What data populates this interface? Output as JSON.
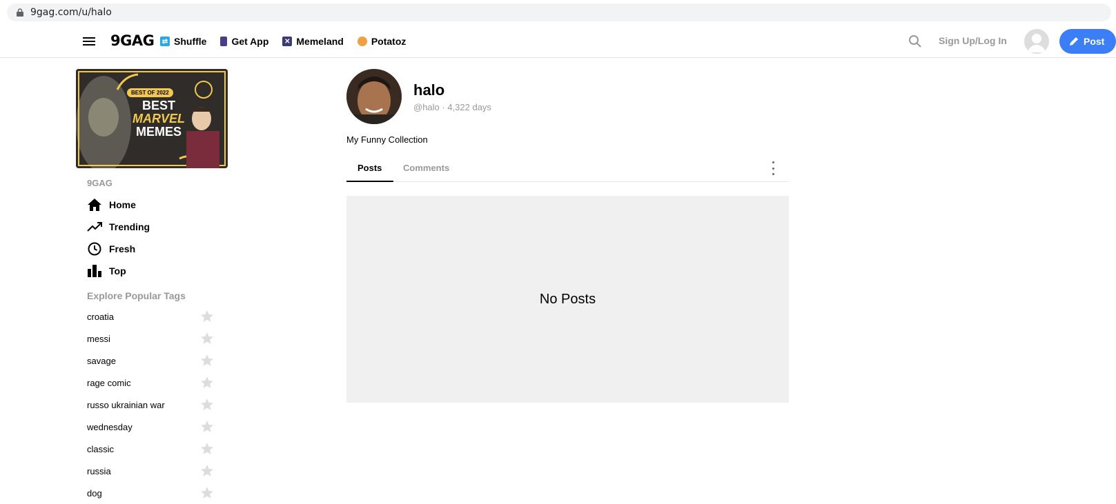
{
  "browser": {
    "url": "9gag.com/u/halo"
  },
  "header": {
    "logo": "9GAG",
    "nav": [
      {
        "label": "Shuffle",
        "icon": "shuffle-icon",
        "color": "#2aa7e8"
      },
      {
        "label": "Get App",
        "icon": "phone-icon",
        "color": "#4a3b8c"
      },
      {
        "label": "Memeland",
        "icon": "memeland-icon",
        "color": "#3b3a7a"
      },
      {
        "label": "Potatoz",
        "icon": "potato-icon",
        "color": "#f0a040"
      }
    ],
    "login_label": "Sign Up/Log In",
    "post_label": "Post"
  },
  "sidebar": {
    "banner": {
      "badge": "BEST OF 2022",
      "line1": "BEST",
      "line2": "MARVEL",
      "line3": "MEMES"
    },
    "section_label": "9GAG",
    "nav": [
      {
        "label": "Home",
        "icon": "home-icon"
      },
      {
        "label": "Trending",
        "icon": "trending-icon"
      },
      {
        "label": "Fresh",
        "icon": "clock-icon"
      },
      {
        "label": "Top",
        "icon": "bar-chart-icon"
      }
    ],
    "tags_title": "Explore Popular Tags",
    "tags": [
      "croatia",
      "messi",
      "savage",
      "rage comic",
      "russo ukrainian war",
      "wednesday",
      "classic",
      "russia",
      "dog"
    ]
  },
  "profile": {
    "name": "halo",
    "handle": "@halo · 4,322 days",
    "bio": "My Funny Collection",
    "tabs": [
      "Posts",
      "Comments"
    ],
    "empty_message": "No Posts"
  },
  "colors": {
    "accent": "#3b7ef5",
    "muted": "#999999",
    "panel": "#f0f0f0"
  }
}
